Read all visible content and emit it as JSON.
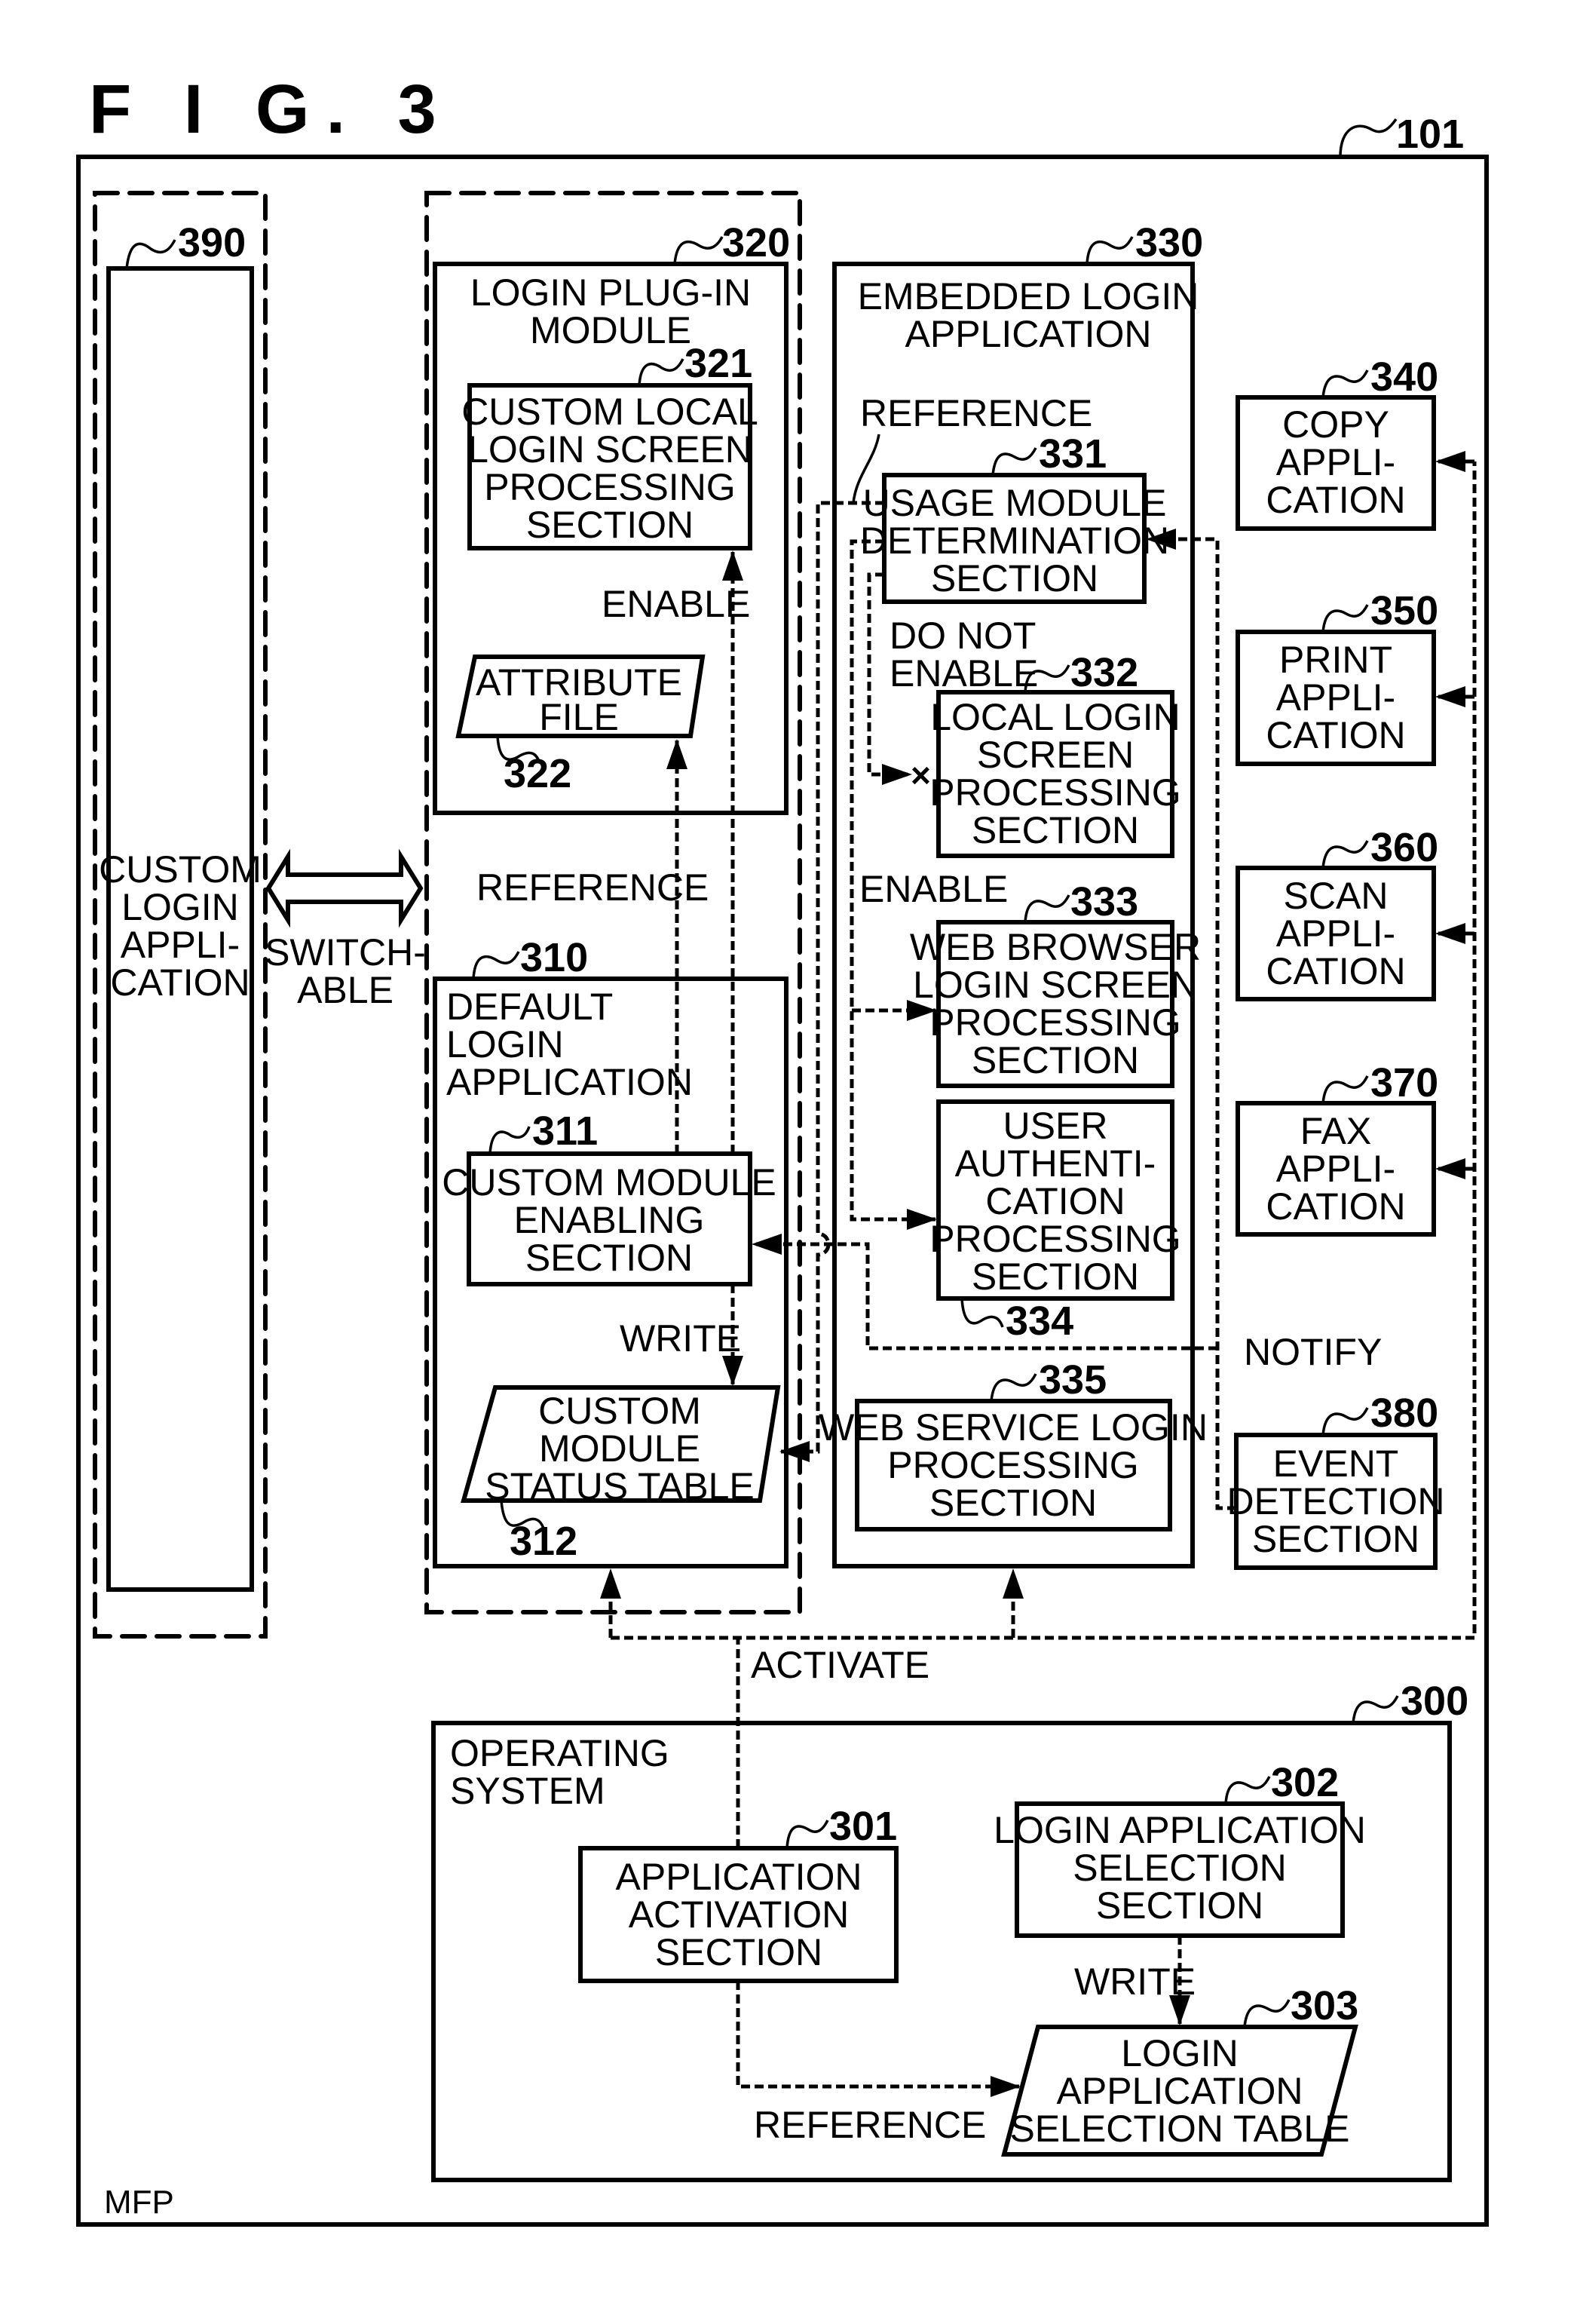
{
  "figure": {
    "title": "F I G. 3",
    "device_label": "MFP",
    "device_ref": "101"
  },
  "blocks": {
    "custom_login_app": {
      "ref": "390",
      "lines": [
        "CUSTOM",
        "LOGIN",
        "APPLI-",
        "CATION"
      ]
    },
    "switchable": {
      "lines": [
        "SWITCH-",
        "ABLE"
      ]
    },
    "login_plugin_module": {
      "ref": "320",
      "lines": [
        "LOGIN PLUG-IN",
        "MODULE"
      ]
    },
    "custom_local_login_screen": {
      "ref": "321",
      "lines": [
        "CUSTOM LOCAL",
        "LOGIN SCREEN",
        "PROCESSING",
        "SECTION"
      ]
    },
    "attribute_file": {
      "ref": "322",
      "lines": [
        "ATTRIBUTE",
        "FILE"
      ]
    },
    "default_login_app": {
      "ref": "310",
      "lines": [
        "DEFAULT",
        "LOGIN",
        "APPLICATION"
      ]
    },
    "custom_module_enabling": {
      "ref": "311",
      "lines": [
        "CUSTOM MODULE",
        "ENABLING",
        "SECTION"
      ]
    },
    "custom_module_status_table": {
      "ref": "312",
      "lines": [
        "CUSTOM",
        "MODULE",
        "STATUS TABLE"
      ]
    },
    "embedded_login_app": {
      "ref": "330",
      "lines": [
        "EMBEDDED LOGIN",
        "APPLICATION"
      ]
    },
    "usage_module_determination": {
      "ref": "331",
      "lines": [
        "USAGE MODULE",
        "DETERMINATION",
        "SECTION"
      ]
    },
    "local_login_screen": {
      "ref": "332",
      "lines": [
        "LOCAL LOGIN",
        "SCREEN",
        "PROCESSING",
        "SECTION"
      ]
    },
    "web_browser_login_screen": {
      "ref": "333",
      "lines": [
        "WEB BROWSER",
        "LOGIN SCREEN",
        "PROCESSING",
        "SECTION"
      ]
    },
    "user_authentication": {
      "ref": "334",
      "lines": [
        "USER",
        "AUTHENTI-",
        "CATION",
        "PROCESSING",
        "SECTION"
      ]
    },
    "web_service_login": {
      "ref": "335",
      "lines": [
        "WEB SERVICE LOGIN",
        "PROCESSING",
        "SECTION"
      ]
    },
    "copy_app": {
      "ref": "340",
      "lines": [
        "COPY",
        "APPLI-",
        "CATION"
      ]
    },
    "print_app": {
      "ref": "350",
      "lines": [
        "PRINT",
        "APPLI-",
        "CATION"
      ]
    },
    "scan_app": {
      "ref": "360",
      "lines": [
        "SCAN",
        "APPLI-",
        "CATION"
      ]
    },
    "fax_app": {
      "ref": "370",
      "lines": [
        "FAX",
        "APPLI-",
        "CATION"
      ]
    },
    "event_detection": {
      "ref": "380",
      "lines": [
        "EVENT",
        "DETECTION",
        "SECTION"
      ]
    },
    "operating_system": {
      "ref": "300",
      "lines": [
        "OPERATING",
        "SYSTEM"
      ]
    },
    "app_activation": {
      "ref": "301",
      "lines": [
        "APPLICATION",
        "ACTIVATION",
        "SECTION"
      ]
    },
    "login_app_selection": {
      "ref": "302",
      "lines": [
        "LOGIN APPLICATION",
        "SELECTION",
        "SECTION"
      ]
    },
    "login_app_selection_table": {
      "ref": "303",
      "lines": [
        "LOGIN",
        "APPLICATION",
        "SELECTION TABLE"
      ]
    }
  },
  "edge_labels": {
    "enable_321": "ENABLE",
    "reference_322": "REFERENCE",
    "write_312": "WRITE",
    "reference_331": "REFERENCE",
    "do_not_enable": [
      "DO NOT",
      "ENABLE"
    ],
    "enable_333": "ENABLE",
    "notify": "NOTIFY",
    "activate": "ACTIVATE",
    "write_303": "WRITE",
    "reference_303": "REFERENCE",
    "blocked_marker": "×"
  }
}
